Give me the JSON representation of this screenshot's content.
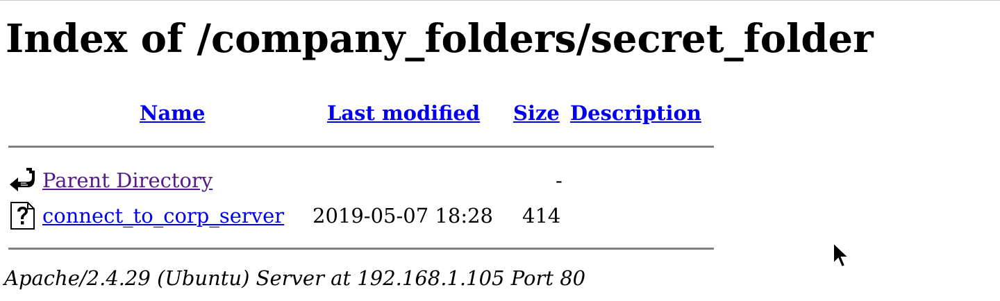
{
  "page": {
    "title": "Index of /company_folders/secret_folder"
  },
  "table": {
    "headers": {
      "name": "Name",
      "last_modified": "Last modified",
      "size": "Size",
      "description": "Description"
    },
    "rows": [
      {
        "icon": "back-arrow-icon",
        "name": "Parent Directory",
        "last_modified": "",
        "size": "-",
        "description": "",
        "visited": true
      },
      {
        "icon": "unknown-file-icon",
        "name": "connect_to_corp_server",
        "last_modified": "2019-05-07 18:28",
        "size": "414",
        "description": "",
        "visited": false
      }
    ]
  },
  "footer": {
    "address": "Apache/2.4.29 (Ubuntu) Server at 192.168.1.105 Port 80"
  },
  "colors": {
    "link": "#0000ee",
    "visited_link": "#551a8b",
    "rule": "#7f7f7f"
  }
}
